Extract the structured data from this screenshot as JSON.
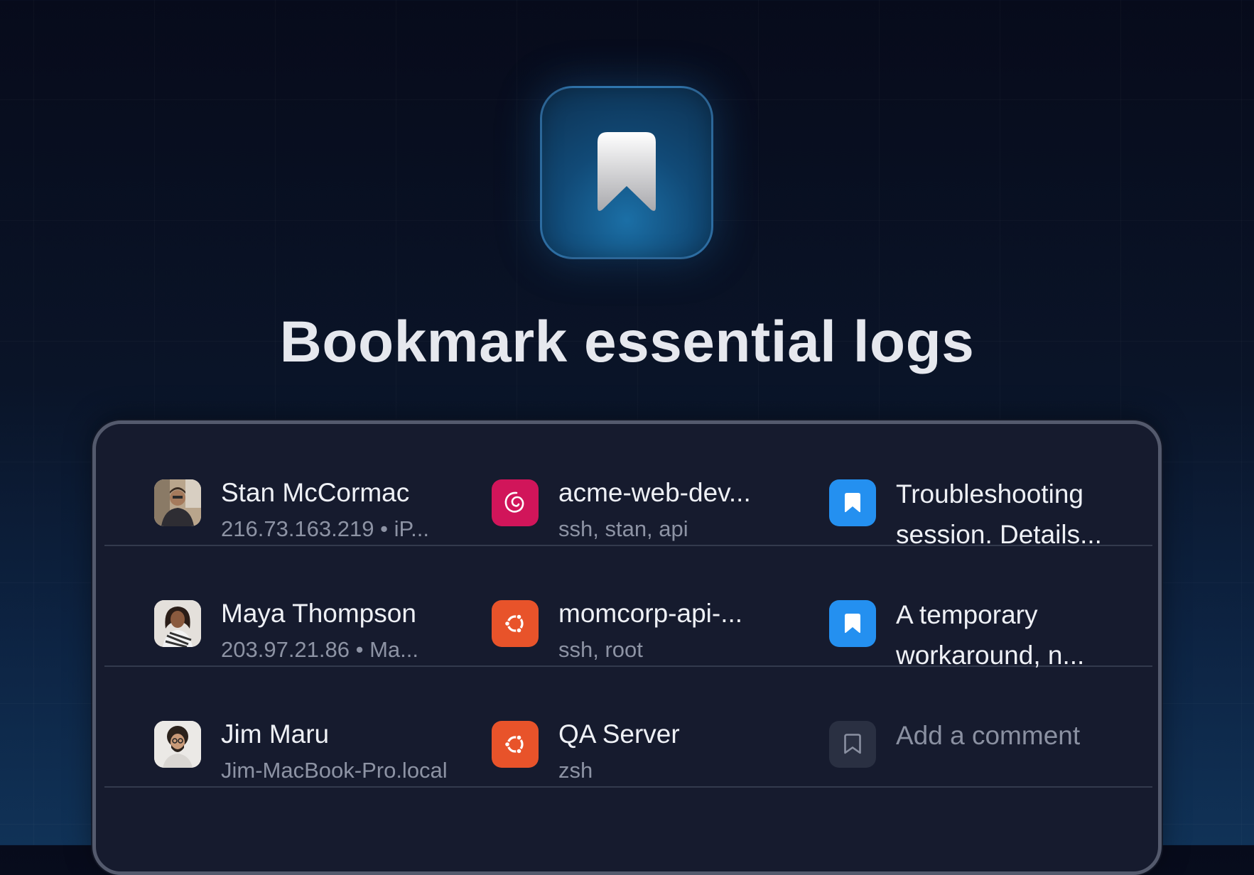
{
  "headline": "Bookmark essential logs",
  "colors": {
    "debian_tile": "#d1155a",
    "ubuntu_tile": "#e8532a",
    "bookmark_active": "#2490f0",
    "bookmark_empty": "#2a3042"
  },
  "rows": [
    {
      "user": {
        "name": "Stan McCormac",
        "detail": "216.73.163.219 • iP...",
        "avatar": "avatar-stan"
      },
      "host": {
        "name": "acme-web-dev...",
        "detail": "ssh, stan, api",
        "icon": "debian-icon"
      },
      "comment": {
        "text": "Troubleshooting session. Details...",
        "bookmarked": true,
        "icon": "bookmark-icon"
      }
    },
    {
      "user": {
        "name": "Maya Thompson",
        "detail": "203.97.21.86 • Ma...",
        "avatar": "avatar-maya"
      },
      "host": {
        "name": "momcorp-api-...",
        "detail": "ssh, root",
        "icon": "ubuntu-icon"
      },
      "comment": {
        "text": "A temporary workaround, n...",
        "bookmarked": true,
        "icon": "bookmark-icon"
      }
    },
    {
      "user": {
        "name": "Jim Maru",
        "detail": "Jim-MacBook-Pro.local",
        "avatar": "avatar-jim"
      },
      "host": {
        "name": "QA Server",
        "detail": "zsh",
        "icon": "ubuntu-icon"
      },
      "comment": {
        "text": "Add a comment",
        "bookmarked": false,
        "icon": "bookmark-outline-icon"
      }
    }
  ]
}
